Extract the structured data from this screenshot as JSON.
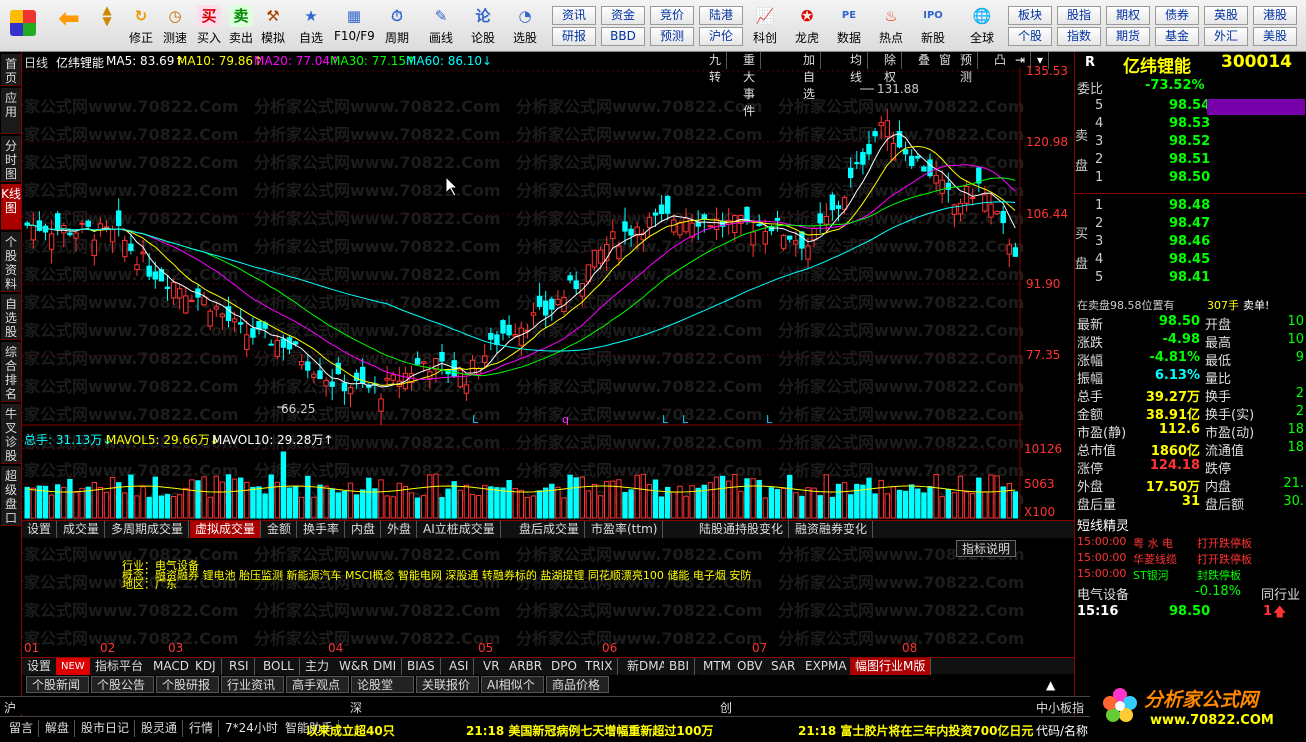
{
  "toolbar": {
    "buttons": [
      "买入",
      "卖出",
      "模拟",
      "自选",
      "F10/F9",
      "周期",
      "画线",
      "论股",
      "选股"
    ],
    "icon_btns": [
      "修正",
      "测速"
    ],
    "grid1": [
      [
        "资讯",
        "资金",
        "竞价",
        "陆港"
      ],
      [
        "研报",
        "BBD",
        "预测",
        "沪伦"
      ]
    ],
    "mid": [
      "科创",
      "龙虎",
      "数据",
      "热点",
      "新股",
      "全球"
    ],
    "grid2": [
      [
        "板块",
        "股指",
        "期权",
        "债券",
        "英股",
        "港股"
      ],
      [
        "个股",
        "指数",
        "期货",
        "基金",
        "外汇",
        "美股"
      ]
    ]
  },
  "left_tabs": [
    "首页",
    "应用",
    "分时图",
    "K线图",
    "个股资料",
    "自选股",
    "综合排名",
    "牛叉诊股",
    "超级盘口"
  ],
  "chart": {
    "ma_line": {
      "period": "日线",
      "name": "亿纬锂能",
      "ma5": "MA5: 83.69↑",
      "ma10": "MA10: 79.86↑",
      "ma20": "MA20: 77.04↑",
      "ma30": "MA30: 77.15↑",
      "ma60": "MA60: 86.10↓"
    },
    "top_tools": [
      "九转",
      "重大事件",
      "加自选",
      "均线",
      "除权",
      "叠",
      "窗",
      "预测",
      "凸"
    ],
    "price_axis": [
      "135.53",
      "120.98",
      "106.44",
      "91.90",
      "77.35"
    ],
    "high_label": "131.88",
    "low_label": "66.25",
    "signals": [
      "L",
      "q",
      "L",
      "L",
      "L"
    ],
    "vol_line": {
      "total": "总手: 31.13万↓",
      "mavol5": "MAVOL5: 29.66万↓",
      "mavol10": "MAVOL10: 29.28万↑"
    },
    "vol_axis": [
      "10126",
      "5063",
      "X100"
    ],
    "indicator_tabs": [
      "设置",
      "成交量",
      "多周期成交量",
      "虚拟成交量",
      "金额",
      "换手率",
      "内盘",
      "外盘",
      "AI立桩成交量",
      "盘后成交量",
      "市盈率(ttm)",
      "陆股通持股变化",
      "融资融券变化"
    ],
    "ind_explain": "指标说明",
    "industry": "行业：电气设备",
    "concept": "概念：融资融券 锂电池 胎压监测 新能源汽车 MSCI概念 智能电网 深股通 转融券标的 盐湖提锂 同花顺漂亮100 储能 电子烟 安防",
    "region": "地区：广东",
    "months": [
      "01",
      "02",
      "03",
      "04",
      "05",
      "06",
      "07",
      "08"
    ],
    "indicators": [
      "设置",
      "NEW",
      "指标平台",
      "MACD",
      "KDJ",
      "RSI",
      "BOLL",
      "主力",
      "W&R",
      "DMI",
      "BIAS",
      "ASI",
      "VR",
      "ARBR",
      "DPO",
      "TRIX",
      "新DMA",
      "BBI",
      "MTM",
      "OBV",
      "SAR",
      "EXPMA",
      "幅图行业M版"
    ],
    "watermark": "分析家公式网www.70822.Com"
  },
  "right": {
    "badge": "R",
    "name": "亿纬锂能",
    "code": "300014",
    "wb_label": "委比",
    "wb": "-73.52%",
    "sell_label": "卖盘",
    "buy_label": "买盘",
    "sells": [
      [
        "5",
        "98.54"
      ],
      [
        "4",
        "98.53"
      ],
      [
        "3",
        "98.52"
      ],
      [
        "2",
        "98.51"
      ],
      [
        "1",
        "98.50"
      ]
    ],
    "buys": [
      [
        "1",
        "98.48"
      ],
      [
        "2",
        "98.47"
      ],
      [
        "3",
        "98.46"
      ],
      [
        "4",
        "98.45"
      ],
      [
        "5",
        "98.41"
      ]
    ],
    "status": "在卖盘98.58位置有",
    "status_n": "307手",
    "status_tag": "卖单!",
    "stats": [
      [
        "最新",
        "98.50",
        "开盘",
        "10"
      ],
      [
        "涨跌",
        "-4.98",
        "最高",
        "10"
      ],
      [
        "涨幅",
        "-4.81%",
        "最低",
        "9"
      ],
      [
        "振幅",
        "6.13%",
        "量比",
        ""
      ],
      [
        "总手",
        "39.27万",
        "换手",
        "2"
      ],
      [
        "金额",
        "38.91亿",
        "换手(实)",
        "2"
      ],
      [
        "市盈(静)",
        "112.6",
        "市盈(动)",
        "18"
      ],
      [
        "总市值",
        "1860亿",
        "流通值",
        "18"
      ],
      [
        "涨停",
        "124.18",
        "跌停",
        ""
      ],
      [
        "外盘",
        "17.50万",
        "内盘",
        "21."
      ],
      [
        "盘后量",
        "31",
        "盘后额",
        "30."
      ]
    ],
    "short_title": "短线精灵",
    "short": [
      [
        "15:00:00",
        "粤 水 电",
        "打开跌停板"
      ],
      [
        "15:00:00",
        "华菱线缆",
        "打开跌停板"
      ],
      [
        "15:00:00",
        "ST银河",
        "封跌停板"
      ]
    ],
    "sector": "电气设备",
    "sector_pct": "-0.18%",
    "sector_rank": "同行业",
    "tick_time": "15:16",
    "tick_price": "98.50",
    "tick_vol": "1"
  },
  "bottom": {
    "news_tabs": [
      "个股新闻",
      "个股公告",
      "个股研报",
      "行业资讯",
      "高手观点",
      "论股堂",
      "关联报价",
      "AI相似个股",
      "商品价格"
    ],
    "idx": [
      "沪",
      "深",
      "创",
      "中小板指"
    ],
    "status": [
      "留言",
      "解盘",
      "股市日记",
      "股灵通",
      "行情",
      "7*24小时",
      "智能助手"
    ],
    "ticker1": "以来成立超40只",
    "ticker2": "21:18 美国新冠病例七天增幅重新超过100万",
    "ticker3": "21:18 富士胶片将在三年内投资700亿日元",
    "tail": "代码/名称",
    "logo": "分析家公式网",
    "logo_url": "www.70822.COM"
  }
}
